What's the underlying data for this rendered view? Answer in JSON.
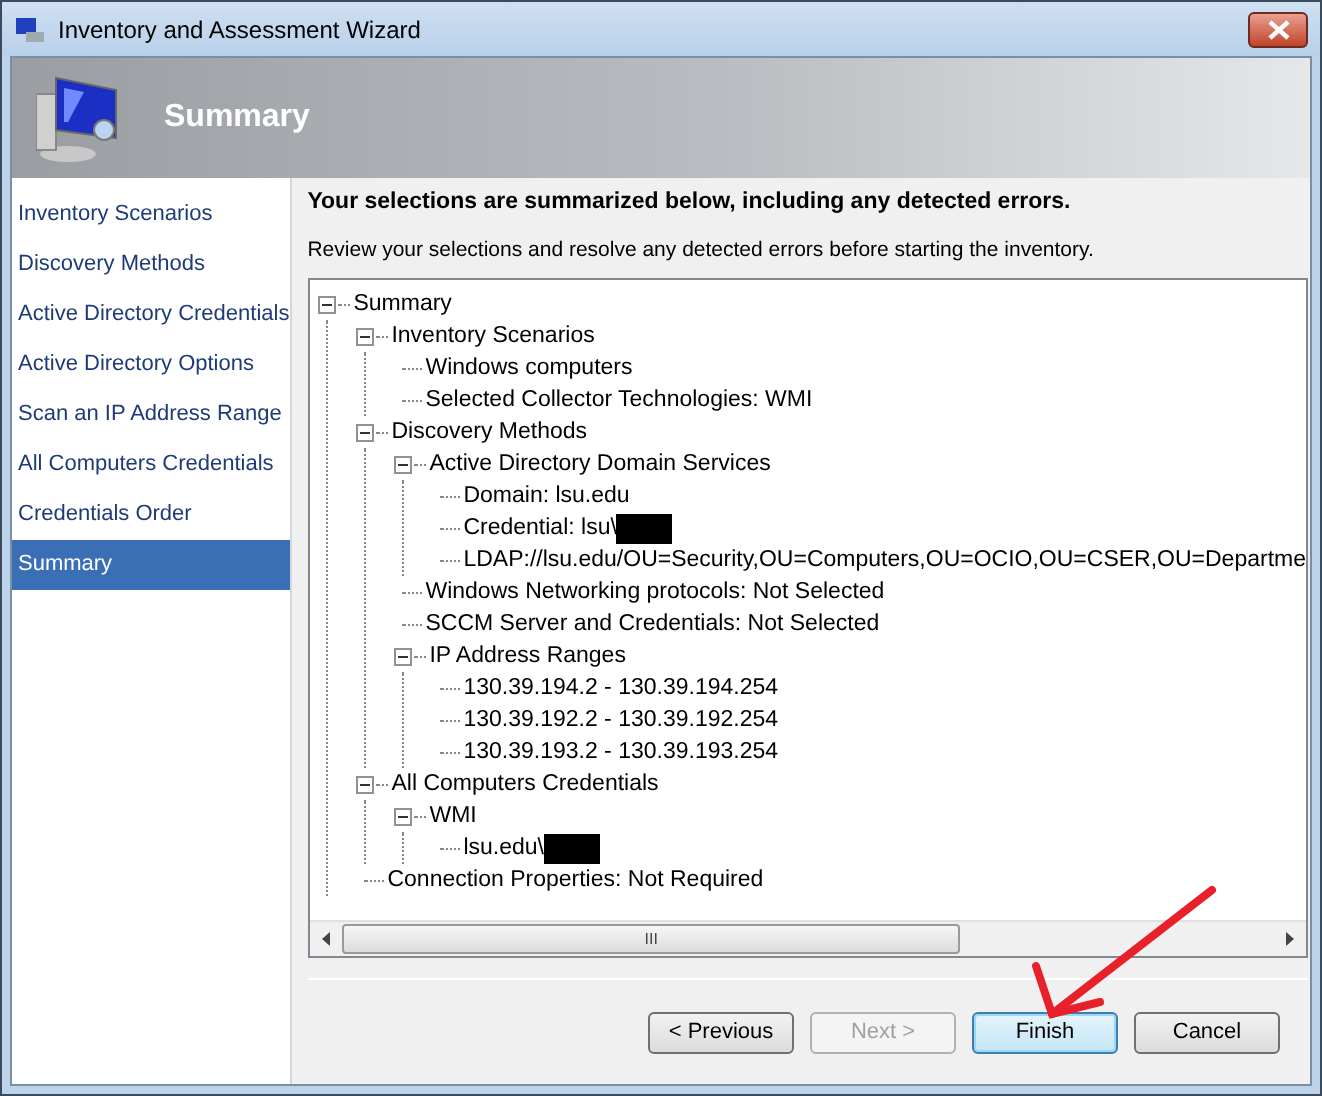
{
  "window": {
    "title": "Inventory and Assessment Wizard"
  },
  "banner": {
    "title": "Summary"
  },
  "sidebar": {
    "items": [
      {
        "label": "Inventory Scenarios",
        "selected": false
      },
      {
        "label": "Discovery Methods",
        "selected": false
      },
      {
        "label": "Active Directory Credentials",
        "selected": false
      },
      {
        "label": "Active Directory Options",
        "selected": false
      },
      {
        "label": "Scan an IP Address Range",
        "selected": false
      },
      {
        "label": "All Computers Credentials",
        "selected": false
      },
      {
        "label": "Credentials Order",
        "selected": false
      },
      {
        "label": "Summary",
        "selected": true
      }
    ]
  },
  "heading": "Your selections are summarized below, including any detected errors.",
  "instructions": "Review your selections and resolve any detected errors before starting the inventory.",
  "tree": [
    {
      "label": "Summary",
      "expanded": true,
      "children": [
        {
          "label": "Inventory Scenarios",
          "expanded": true,
          "children": [
            {
              "label": "Windows computers"
            },
            {
              "label": "Selected Collector Technologies: WMI"
            }
          ]
        },
        {
          "label": "Discovery Methods",
          "expanded": true,
          "children": [
            {
              "label": "Active Directory Domain Services",
              "expanded": true,
              "children": [
                {
                  "label": "Domain: lsu.edu"
                },
                {
                  "label": "Credential: lsu\\",
                  "redacted": true
                },
                {
                  "label": "LDAP://lsu.edu/OU=Security,OU=Computers,OU=OCIO,OU=CSER,OU=Departme"
                }
              ]
            },
            {
              "label": "Windows Networking protocols: Not Selected"
            },
            {
              "label": "SCCM Server and Credentials: Not Selected"
            },
            {
              "label": "IP Address Ranges",
              "expanded": true,
              "children": [
                {
                  "label": "130.39.194.2 - 130.39.194.254"
                },
                {
                  "label": "130.39.192.2 - 130.39.192.254"
                },
                {
                  "label": "130.39.193.2 - 130.39.193.254"
                }
              ]
            }
          ]
        },
        {
          "label": "All Computers Credentials",
          "expanded": true,
          "children": [
            {
              "label": "WMI",
              "expanded": true,
              "children": [
                {
                  "label": "lsu.edu\\",
                  "redacted": true
                }
              ]
            }
          ]
        },
        {
          "label": "Connection Properties: Not Required"
        }
      ]
    }
  ],
  "scrollbar_grip": "III",
  "buttons": [
    {
      "label": "< Previous",
      "disabled": false,
      "default": false
    },
    {
      "label": "Next >",
      "disabled": true,
      "default": false
    },
    {
      "label": "Finish",
      "disabled": false,
      "default": true
    },
    {
      "label": "Cancel",
      "disabled": false,
      "default": false
    }
  ]
}
